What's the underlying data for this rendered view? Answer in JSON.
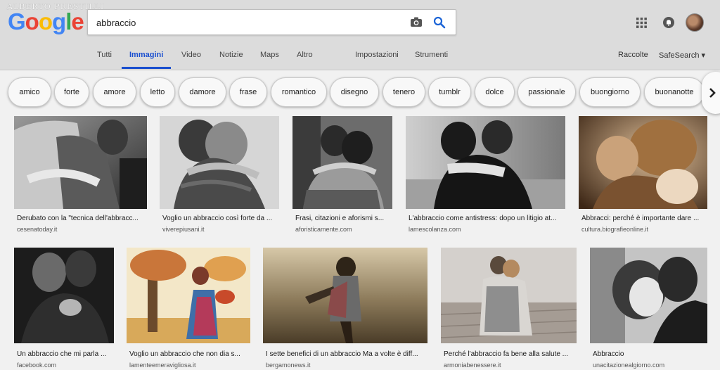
{
  "watermark": "ALBERTO PRESTILLI",
  "logo": {
    "letters": [
      "G",
      "o",
      "o",
      "g",
      "l",
      "e"
    ]
  },
  "colors": {
    "blue": "#4285F4",
    "red": "#EA4335",
    "yellow": "#FBBC05",
    "green": "#34A853",
    "accent": "#1a4fcf"
  },
  "search": {
    "value": "abbraccio",
    "camera_icon": "camera-icon",
    "search_icon": "search-icon"
  },
  "nav": {
    "tabs": [
      "Tutti",
      "Immagini",
      "Video",
      "Notizie",
      "Maps",
      "Altro"
    ],
    "active": "Immagini",
    "tools": [
      "Impostazioni",
      "Strumenti"
    ],
    "right": {
      "collections": "Raccolte",
      "safesearch": "SafeSearch ▾"
    }
  },
  "chips": [
    "amico",
    "forte",
    "amore",
    "letto",
    "damore",
    "frase",
    "romantico",
    "disegno",
    "tenero",
    "tumblr",
    "dolce",
    "passionale",
    "buongiorno",
    "buonanotte"
  ],
  "results": [
    {
      "title": "Derubato con la \"tecnica dell'abbracc...",
      "source": "cesenatoday.it"
    },
    {
      "title": "Voglio un abbraccio così forte da ...",
      "source": "viverepiusani.it"
    },
    {
      "title": "Frasi, citazioni e aforismi s...",
      "source": "aforisticamente.com"
    },
    {
      "title": "L'abbraccio come antistress: dopo un litigio at...",
      "source": "lamescolanza.com"
    },
    {
      "title": "Abbracci: perché è importante dare ...",
      "source": "cultura.biografieonline.it"
    },
    {
      "title": "Un abbraccio che mi parla ...",
      "source": "facebook.com"
    },
    {
      "title": "Voglio un abbraccio che non dia s...",
      "source": "lamenteemeravigliosa.it"
    },
    {
      "title": "I sette benefici di un abbraccio Ma a volte è diff...",
      "source": "bergamonews.it"
    },
    {
      "title": "Perché l'abbraccio fa bene alla salute ...",
      "source": "armoniabenessere.it"
    },
    {
      "title": "Abbraccio",
      "source": "unacitazionealgiorno.com"
    }
  ]
}
